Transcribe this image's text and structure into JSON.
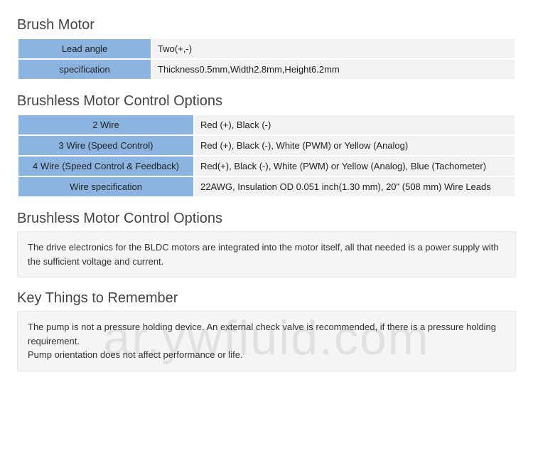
{
  "section1": {
    "title": "Brush Motor",
    "rows": [
      {
        "label": "Lead angle",
        "value": "Two(+,-)"
      },
      {
        "label": "specification",
        "value": "Thickness0.5mm,Width2.8mm,Height6.2mm"
      }
    ]
  },
  "section2": {
    "title": "Brushless Motor Control Options",
    "rows": [
      {
        "label": "2 Wire",
        "value": "Red (+), Black (-)"
      },
      {
        "label": "3 Wire (Speed Control)",
        "value": "Red (+), Black (-), White (PWM) or Yellow (Analog)"
      },
      {
        "label": "4 Wire (Speed Control & Feedback)",
        "value": "Red(+), Black (-), White (PWM) or Yellow (Analog), Blue (Tachometer)"
      },
      {
        "label": "Wire specification",
        "value": "22AWG, Insulation OD 0.051 inch(1.30 mm), 20\" (508 mm) Wire Leads"
      }
    ]
  },
  "section3": {
    "title": "Brushless Motor Control Options",
    "text": "The drive electronics for the BLDC motors are integrated into the motor itself, all that needed is a power supply with the sufficient voltage and current."
  },
  "section4": {
    "title": "Key Things to Remember",
    "text1": "The pump is not a pressure holding device. An external check valve is recommended, if there is a pressure holding requirement.",
    "text2": "Pump orientation does not affect performance or life."
  },
  "watermark": "ar.ywfluid.com"
}
